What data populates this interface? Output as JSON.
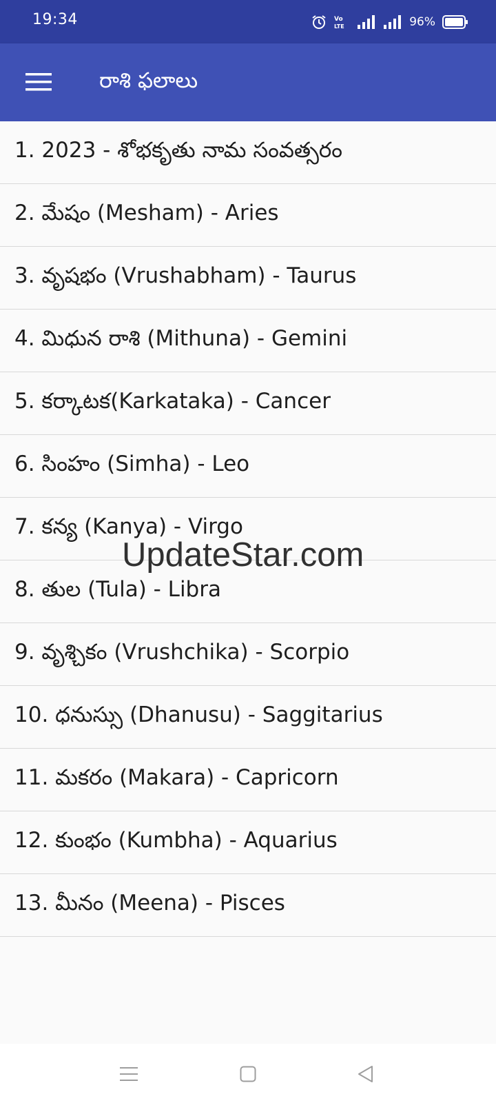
{
  "status_bar": {
    "time": "19:34",
    "battery": "96%",
    "icons": [
      "alarm-icon",
      "volte-icon",
      "signal-icon",
      "signal-icon",
      "battery-icon"
    ]
  },
  "app_bar": {
    "title": "రాశి ఫలాలు",
    "menu_icon": "hamburger-menu-icon"
  },
  "list": {
    "items": [
      "1. 2023 - శోభకృతు నామ సంవత్సరం",
      "2. మేషం (Mesham) - Aries",
      "3. వృషభం (Vrushabham) - Taurus",
      "4. మిధున రాశి (Mithuna) - Gemini",
      "5. కర్కాటక(Karkataka) - Cancer",
      "6. సింహం (Simha) - Leo",
      "7. కన్య (Kanya) - Virgo",
      "8. తుల (Tula) - Libra",
      "9. వృశ్చికం (Vrushchika) - Scorpio",
      "10. ధనుస్సు (Dhanusu) - Saggitarius",
      "11. మకరం (Makara) - Capricorn",
      "12. కుంభం (Kumbha) - Aquarius",
      "13. మీనం (Meena) - Pisces"
    ]
  },
  "watermark": "UpdateStar.com",
  "nav_bar": {
    "icons": [
      "recents-icon",
      "home-icon",
      "back-icon"
    ]
  },
  "colors": {
    "status_bar": "#2f3e9e",
    "app_bar": "#3f51b5",
    "background": "#fafafa"
  }
}
